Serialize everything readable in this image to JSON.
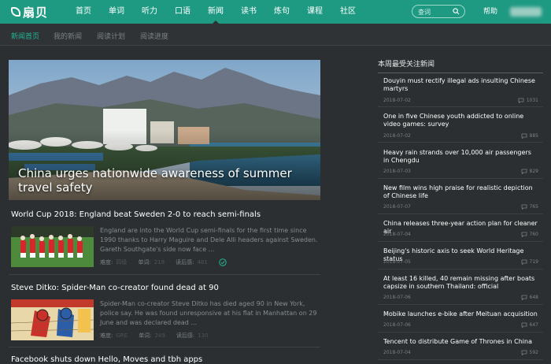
{
  "app": {
    "logo_text": "扇贝"
  },
  "topnav": {
    "items": [
      "首页",
      "单词",
      "听力",
      "口语",
      "新闻",
      "读书",
      "炼句",
      "课程",
      "社区"
    ],
    "search_placeholder": "查词",
    "help": "帮助"
  },
  "subnav": {
    "items": [
      "新闻首页",
      "我的新闻",
      "阅读计划",
      "阅读进度"
    ]
  },
  "hero": {
    "title": "China urges nationwide awareness of summer travel safety"
  },
  "articles": [
    {
      "title": "World Cup 2018: England beat Sweden 2-0 to reach semi-finals",
      "desc": "England are into the World Cup semi-finals for the first time since 1990 thanks to Harry Maguire and Dele Alli headers against Sweden. Gareth Southgate's side now face ...",
      "difficulty_label": "难度:",
      "difficulty": "四级",
      "words_label": "单词:",
      "words": "218",
      "readers_label": "读后感:",
      "readers": "481"
    },
    {
      "title": "Steve Ditko: Spider-Man co-creator found dead at 90",
      "desc": "Spider-Man co-creator Steve Ditko has died aged 90 in New York, police say. He was found unresponsive at his flat in Manhattan on 29 June and was declared dead ...",
      "difficulty_label": "难度:",
      "difficulty": "GRE",
      "words_label": "单词:",
      "words": "249",
      "readers_label": "读后感:",
      "readers": "130"
    },
    {
      "title": "Facebook shuts down Hello, Moves and tbh apps"
    }
  ],
  "sidebar": {
    "title": "本周最受关注新闻",
    "items": [
      {
        "title": "Douyin must rectify illegal ads insulting Chinese martyrs",
        "date": "2018-07-02",
        "count": "1031"
      },
      {
        "title": "One in five Chinese youth addicted to online video games: survey",
        "date": "2018-07-02",
        "count": "885"
      },
      {
        "title": "Heavy rain strands over 10,000 air passengers in Chengdu",
        "date": "2018-07-03",
        "count": "829"
      },
      {
        "title": "New film wins high praise for realistic depiction of Chinese life",
        "date": "2018-07-07",
        "count": "765"
      },
      {
        "title": "China releases three-year action plan for cleaner air",
        "date": "2018-07-04",
        "count": "760"
      },
      {
        "title": "Beijing's historic axis to seek World Heritage status",
        "date": "2018-07-05",
        "count": "719"
      },
      {
        "title": "At least 16 killed, 40 remain missing after boats capsize in southern Thailand: official",
        "date": "2018-07-06",
        "count": "648"
      },
      {
        "title": "Mobike launches e-bike after Meituan acquisition",
        "date": "2018-07-06",
        "count": "647"
      },
      {
        "title": "Tencent to distribute Game of Thrones in China",
        "date": "2018-07-04",
        "count": "592"
      }
    ]
  },
  "colors": {
    "brand": "#1f9a82",
    "accent": "#23b597",
    "background": "#2b2f31"
  },
  "icons": {
    "search": "search-icon",
    "read_done": "check-circle-icon",
    "comments": "comment-icon"
  }
}
